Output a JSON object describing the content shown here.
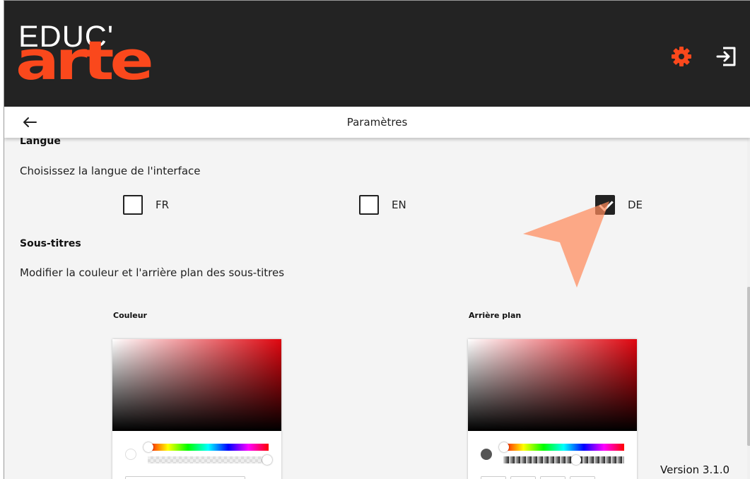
{
  "header": {
    "logo_top": "EDUC'",
    "logo_bottom": "arte",
    "brand_color": "#fa481c",
    "settings_icon": "gear-icon",
    "logout_icon": "logout-icon"
  },
  "subheader": {
    "back_icon": "arrow-left-icon",
    "title": "Paramètres"
  },
  "language": {
    "section_title": "Langue",
    "description": "Choisissez la langue de l'interface",
    "options": [
      {
        "label": "FR",
        "checked": false
      },
      {
        "label": "EN",
        "checked": false
      },
      {
        "label": "DE",
        "checked": true
      }
    ]
  },
  "subtitles": {
    "section_title": "Sous-titres",
    "description": "Modifier la couleur et l'arrière plan des sous-titres",
    "color_picker": {
      "title": "Couleur"
    },
    "background_picker": {
      "title": "Arrière plan"
    }
  },
  "footer": {
    "version": "Version 3.1.0"
  }
}
